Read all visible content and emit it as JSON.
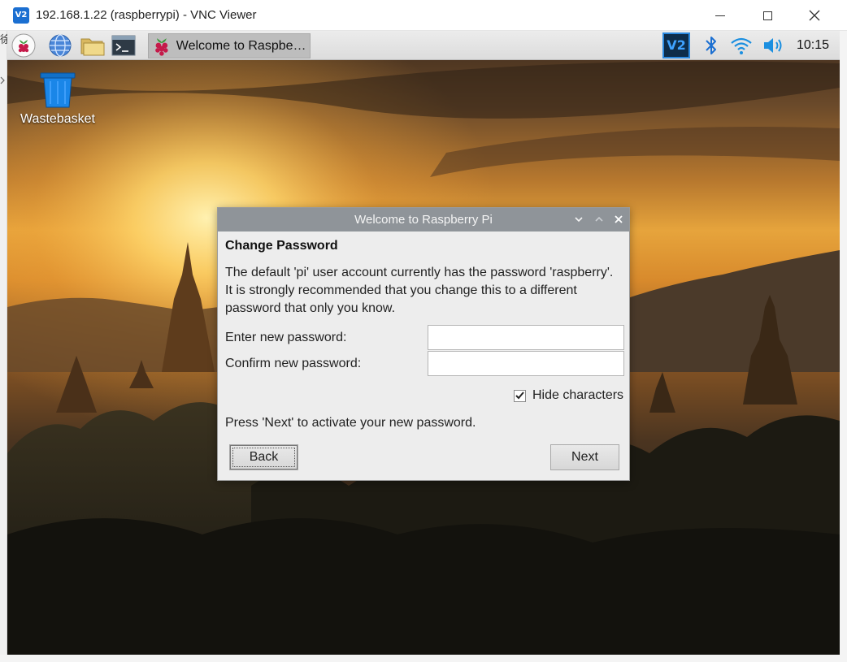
{
  "vnc_window": {
    "title": "192.168.1.22 (raspberrypi) - VNC Viewer",
    "logo_text": "V2",
    "left_fragment": "徐",
    "controls": [
      "minimize-icon",
      "maximize-icon",
      "close-icon"
    ]
  },
  "taskbar": {
    "launchers": [
      "raspberry-menu-icon",
      "web-browser-icon",
      "file-manager-icon",
      "terminal-icon"
    ],
    "active_task_label": "Welcome to Raspberr...",
    "tray": {
      "vnc_label": "V2",
      "icons": [
        "vnc-server-icon",
        "bluetooth-icon",
        "wifi-icon",
        "volume-icon"
      ],
      "clock": "10:15"
    }
  },
  "desktop": {
    "icons": [
      {
        "label": "Wastebasket",
        "icon": "wastebasket-icon"
      }
    ]
  },
  "dialog": {
    "title": "Welcome to Raspberry Pi",
    "heading": "Change Password",
    "body": "The default 'pi' user account currently has the password 'raspberry'. It is strongly recommended that you change this to a different password that only you know.",
    "new_password_label": "Enter new password:",
    "new_password_value": "",
    "confirm_password_label": "Confirm new password:",
    "confirm_password_value": "",
    "hide_characters_label": "Hide characters",
    "hide_characters_checked": true,
    "hint": "Press 'Next' to activate your new password.",
    "back_label": "Back",
    "next_label": "Next"
  },
  "colors": {
    "dialog_titlebar": "#8f9499",
    "dialog_background": "#ededed",
    "taskbar": "#dcdcdc",
    "vnc_accent": "#2c8ae0"
  }
}
